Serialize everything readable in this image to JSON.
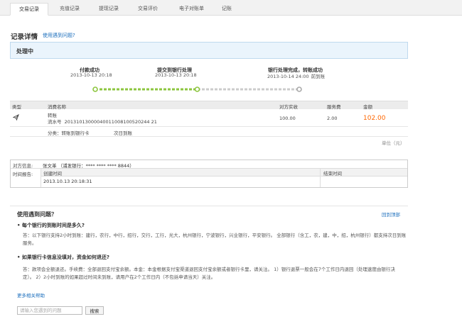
{
  "tabs": [
    {
      "label": "交易记录",
      "active": true
    },
    {
      "label": "充值记录",
      "active": false
    },
    {
      "label": "提现记录",
      "active": false
    },
    {
      "label": "交易评价",
      "active": false
    },
    {
      "label": "电子对账单",
      "active": false
    },
    {
      "label": "记账",
      "active": false
    }
  ],
  "page": {
    "title": "记录详情",
    "help_link": "使用遇到问题?",
    "status": "处理中"
  },
  "progress": {
    "steps": [
      {
        "title": "付款成功",
        "date": "2013-10-13 20:18",
        "sub": ""
      },
      {
        "title": "提交到银行处理",
        "date": "2013-10-13 20:18",
        "sub": ""
      },
      {
        "title": "银行处理完成，转账成功",
        "date": "2013-10-14 24:00",
        "sub": "前到账"
      }
    ],
    "completed_fraction": 0.5,
    "colors": {
      "done": "#8dc63f",
      "pending": "#cccccc"
    }
  },
  "table": {
    "headers": {
      "type": "类型",
      "name": "消费名称",
      "counterparty": "对方实收",
      "fee": "服务费",
      "amount": "金额"
    },
    "row": {
      "type_icon": "plane-transfer-icon",
      "name": "转账",
      "serial_label": "流水号",
      "serial": "20131013000040011008100520244 21",
      "counterparty": "100.00",
      "fee": "2.00",
      "amount": "102.00"
    },
    "category": "分类：转账到银行卡",
    "arrival": "次日到账",
    "unit": "单位（元）"
  },
  "info": {
    "counterparty_label": "对方信息:",
    "counterparty_value": "张文革 （浦发银行：**** **** **** 8844）",
    "time_label": "时间报告:",
    "created_header": "创建时间",
    "end_header": "结束时间",
    "created_value": "2013.10.13 20:18:31",
    "end_value": ""
  },
  "faq": {
    "title": "使用遇到问题？",
    "back_top": "回到顶部",
    "q1": "• 每个银行的到账时间是多久?",
    "a1": "答：以下银行支持2小时到账：建行，农行，中行，招行，交行，工行，光大，杭州银行，宁波银行，兴业银行，平安银行。 全部银行（含工，农，建，中，招，杭州银行）都支持次日到账服务。",
    "q2": "• 如果银行卡信息没填对，资金如何退还?",
    "a2": "答：款项会全额退还。手续费：全部退回支付宝余额。本金：本金根据支付宝渠道退回支付宝余额或者银行卡里，请关注。 1）银行退票一般会在7个工作日内退回（处理速度由银行决定）。 2）2小时到账的如果超过时间未到账，请用户在2个工作日内（不包括申请当天）关注。",
    "more": "更多相关帮助"
  },
  "search": {
    "placeholder": "请输入您遇到的问题",
    "button": "搜索"
  }
}
